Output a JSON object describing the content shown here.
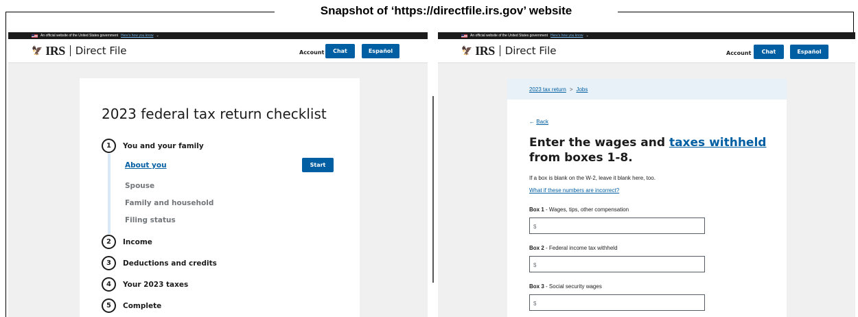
{
  "figure_title": "Snapshot of ‘https://directfile.irs.gov’ website",
  "gov_banner": {
    "text": "An official website of the United States government",
    "link": "Here’s how you know",
    "chevron": "⌄"
  },
  "header": {
    "logo_text": "IRS",
    "app_name": "Direct File",
    "account_label": "Account",
    "chat_label": "Chat",
    "language_label": "Español"
  },
  "checklist": {
    "title": "2023 federal tax return checklist",
    "steps": [
      {
        "number": "1",
        "label": "You and your family"
      },
      {
        "number": "2",
        "label": "Income"
      },
      {
        "number": "3",
        "label": "Deductions and credits"
      },
      {
        "number": "4",
        "label": "Your 2023 taxes"
      },
      {
        "number": "5",
        "label": "Complete"
      }
    ],
    "sub_items": [
      "About you",
      "Spouse",
      "Family and household",
      "Filing status"
    ],
    "start_label": "Start"
  },
  "wages_form": {
    "breadcrumb": [
      "2023 tax return",
      "Jobs"
    ],
    "breadcrumb_sep": ">",
    "back_label": "Back",
    "back_arrow": "←",
    "heading_pre": "Enter the wages and",
    "heading_link": "taxes withheld",
    "heading_post": "from",
    "heading_bold": "boxes 1-8.",
    "help_text": "If a box is blank on the W-2, leave it blank here, too.",
    "help_link": "What if these numbers are incorrect?",
    "fields": [
      {
        "box": "Box 1",
        "label": " - Wages, tips, other compensation",
        "placeholder": "$"
      },
      {
        "box": "Box 2",
        "label": " - Federal income tax withheld",
        "placeholder": "$"
      },
      {
        "box": "Box 3",
        "label": " - Social security wages",
        "placeholder": "$"
      }
    ]
  },
  "colors": {
    "primary": "#005ea2",
    "banner": "#1b1b1b",
    "page_bg": "#f0f0f0",
    "breadcrumb_bg": "#e8f1f8"
  }
}
